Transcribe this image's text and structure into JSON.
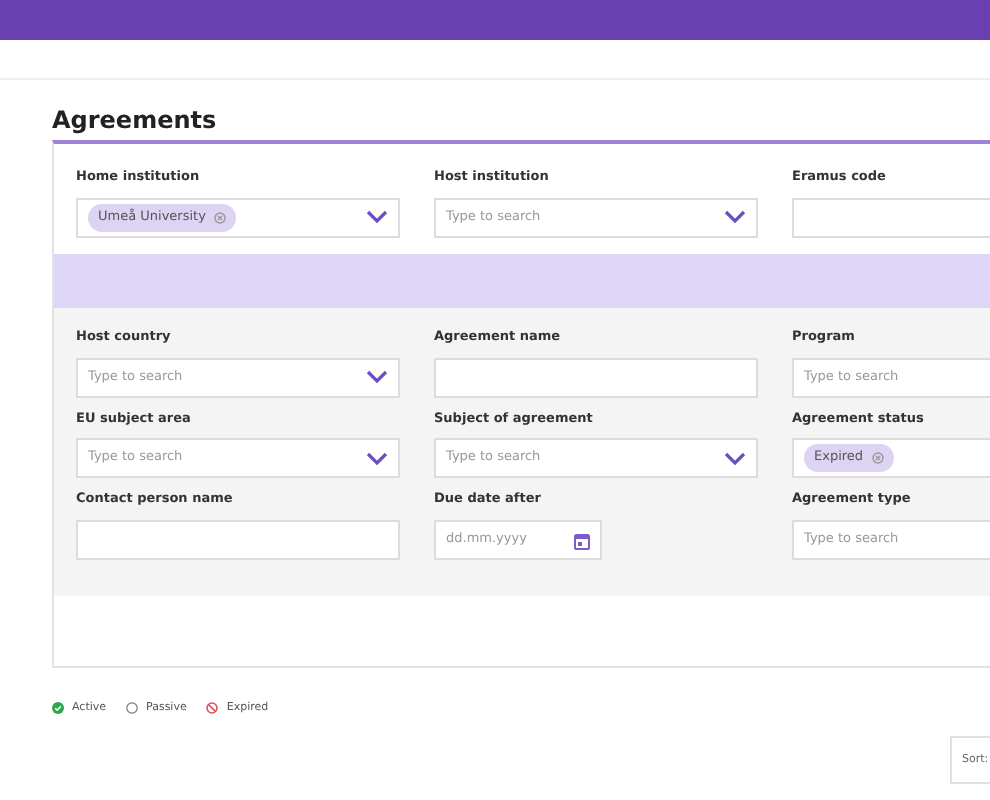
{
  "page": {
    "title": "Agreements"
  },
  "top_fields": [
    {
      "kind": "select",
      "label": "Home institution",
      "chip": "Umeå University"
    },
    {
      "kind": "select",
      "label": "Host institution",
      "placeholder": "Type to search"
    },
    {
      "kind": "text",
      "label": "Eramus code"
    }
  ],
  "filters": [
    {
      "kind": "select",
      "label": "Host country",
      "placeholder": "Type to search"
    },
    {
      "kind": "text",
      "label": "Agreement name"
    },
    {
      "kind": "text",
      "label": "Program",
      "placeholder": "Type to search"
    },
    {
      "kind": "select",
      "label": "EU subject area",
      "placeholder": "Type to search"
    },
    {
      "kind": "select",
      "label": "Subject of agreement",
      "placeholder": "Type to search"
    },
    {
      "kind": "text",
      "label": "Agreement status",
      "chip": "Expired"
    },
    {
      "kind": "text",
      "label": "Contact person name"
    },
    {
      "kind": "date",
      "label": "Due date after",
      "placeholder": "dd.mm.yyyy"
    },
    {
      "kind": "text",
      "label": "Agreement type",
      "placeholder": "Type to search"
    }
  ],
  "legend": [
    {
      "kind": "active",
      "label": "Active"
    },
    {
      "kind": "passive",
      "label": "Passive"
    },
    {
      "kind": "expired",
      "label": "Expired"
    }
  ],
  "sort": {
    "label": "Sort:"
  }
}
